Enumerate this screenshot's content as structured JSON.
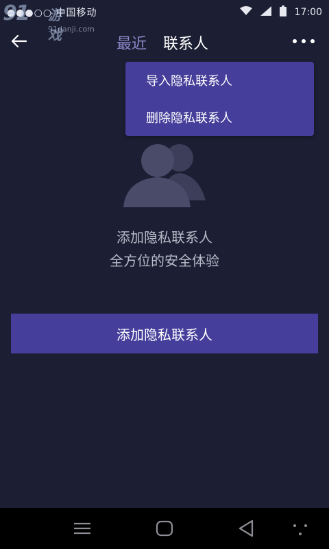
{
  "status_bar": {
    "carrier": "●●●○○ 中国移动",
    "time": "17:00"
  },
  "watermark": {
    "logo": "91",
    "game": "游戏",
    "url": "91danji.com"
  },
  "header": {
    "tab_recent": "最近",
    "tab_contacts": "联系人"
  },
  "dropdown_menu": {
    "items": [
      "导入隐私联系人",
      "删除隐私联系人"
    ]
  },
  "empty_state": {
    "title": "添加隐私联系人",
    "subtitle": "全方位的安全体验"
  },
  "primary_button": {
    "label": "添加隐私联系人"
  },
  "colors": {
    "background": "#1c1e33",
    "accent": "#453e9a",
    "tab_inactive": "#8a87c6",
    "icon": "#4a4b69"
  },
  "icons": [
    "back-arrow-icon",
    "more-icon",
    "contacts-people-icon",
    "wifi-icon",
    "signal-icon",
    "battery-icon",
    "menu-icon",
    "home-icon",
    "back-triangle-icon",
    "overflow-icon"
  ]
}
